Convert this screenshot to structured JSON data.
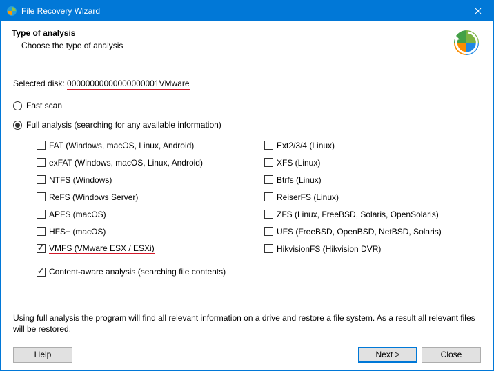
{
  "titlebar": {
    "title": "File Recovery Wizard"
  },
  "header": {
    "title": "Type of analysis",
    "subtitle": "Choose the type of analysis"
  },
  "selected_disk": {
    "label": "Selected disk: ",
    "value": "00000000000000000001VMware"
  },
  "scan_mode": {
    "fast": {
      "label": "Fast scan",
      "checked": false
    },
    "full": {
      "label": "Full analysis (searching for any available information)",
      "checked": true
    }
  },
  "filesystems": {
    "left": [
      {
        "id": "fat",
        "label": "FAT (Windows, macOS, Linux, Android)",
        "checked": false,
        "highlight": false
      },
      {
        "id": "exfat",
        "label": "exFAT (Windows, macOS, Linux, Android)",
        "checked": false,
        "highlight": false
      },
      {
        "id": "ntfs",
        "label": "NTFS (Windows)",
        "checked": false,
        "highlight": false
      },
      {
        "id": "refs",
        "label": "ReFS (Windows Server)",
        "checked": false,
        "highlight": false
      },
      {
        "id": "apfs",
        "label": "APFS (macOS)",
        "checked": false,
        "highlight": false
      },
      {
        "id": "hfs",
        "label": "HFS+ (macOS)",
        "checked": false,
        "highlight": false
      },
      {
        "id": "vmfs",
        "label": "VMFS (VMware ESX / ESXi)",
        "checked": true,
        "highlight": true
      }
    ],
    "right": [
      {
        "id": "ext",
        "label": "Ext2/3/4 (Linux)",
        "checked": false
      },
      {
        "id": "xfs",
        "label": "XFS (Linux)",
        "checked": false
      },
      {
        "id": "btrfs",
        "label": "Btrfs (Linux)",
        "checked": false
      },
      {
        "id": "reiserfs",
        "label": "ReiserFS (Linux)",
        "checked": false
      },
      {
        "id": "zfs",
        "label": "ZFS (Linux, FreeBSD, Solaris, OpenSolaris)",
        "checked": false
      },
      {
        "id": "ufs",
        "label": "UFS (FreeBSD, OpenBSD, NetBSD, Solaris)",
        "checked": false
      },
      {
        "id": "hikfs",
        "label": "HikvisionFS (Hikvision DVR)",
        "checked": false
      }
    ]
  },
  "content_aware": {
    "label": "Content-aware analysis (searching file contents)",
    "checked": true
  },
  "description": "Using full analysis the program will find all relevant information on a drive and restore a file system. As a result all relevant files will be restored.",
  "footer": {
    "help": "Help",
    "next": "Next >",
    "close": "Close"
  }
}
